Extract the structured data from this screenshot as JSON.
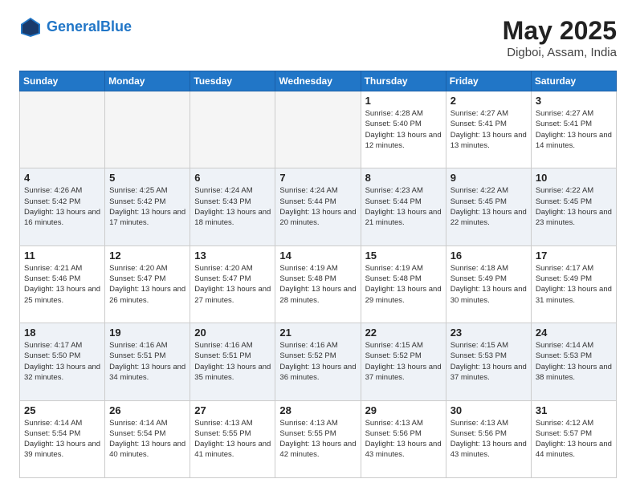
{
  "header": {
    "logo_line1": "General",
    "logo_line2": "Blue",
    "title": "May 2025",
    "subtitle": "Digboi, Assam, India"
  },
  "weekdays": [
    "Sunday",
    "Monday",
    "Tuesday",
    "Wednesday",
    "Thursday",
    "Friday",
    "Saturday"
  ],
  "weeks": [
    [
      {
        "day": "",
        "sunrise": "",
        "sunset": "",
        "daylight": ""
      },
      {
        "day": "",
        "sunrise": "",
        "sunset": "",
        "daylight": ""
      },
      {
        "day": "",
        "sunrise": "",
        "sunset": "",
        "daylight": ""
      },
      {
        "day": "",
        "sunrise": "",
        "sunset": "",
        "daylight": ""
      },
      {
        "day": "1",
        "sunrise": "Sunrise: 4:28 AM",
        "sunset": "Sunset: 5:40 PM",
        "daylight": "Daylight: 13 hours and 12 minutes."
      },
      {
        "day": "2",
        "sunrise": "Sunrise: 4:27 AM",
        "sunset": "Sunset: 5:41 PM",
        "daylight": "Daylight: 13 hours and 13 minutes."
      },
      {
        "day": "3",
        "sunrise": "Sunrise: 4:27 AM",
        "sunset": "Sunset: 5:41 PM",
        "daylight": "Daylight: 13 hours and 14 minutes."
      }
    ],
    [
      {
        "day": "4",
        "sunrise": "Sunrise: 4:26 AM",
        "sunset": "Sunset: 5:42 PM",
        "daylight": "Daylight: 13 hours and 16 minutes."
      },
      {
        "day": "5",
        "sunrise": "Sunrise: 4:25 AM",
        "sunset": "Sunset: 5:42 PM",
        "daylight": "Daylight: 13 hours and 17 minutes."
      },
      {
        "day": "6",
        "sunrise": "Sunrise: 4:24 AM",
        "sunset": "Sunset: 5:43 PM",
        "daylight": "Daylight: 13 hours and 18 minutes."
      },
      {
        "day": "7",
        "sunrise": "Sunrise: 4:24 AM",
        "sunset": "Sunset: 5:44 PM",
        "daylight": "Daylight: 13 hours and 20 minutes."
      },
      {
        "day": "8",
        "sunrise": "Sunrise: 4:23 AM",
        "sunset": "Sunset: 5:44 PM",
        "daylight": "Daylight: 13 hours and 21 minutes."
      },
      {
        "day": "9",
        "sunrise": "Sunrise: 4:22 AM",
        "sunset": "Sunset: 5:45 PM",
        "daylight": "Daylight: 13 hours and 22 minutes."
      },
      {
        "day": "10",
        "sunrise": "Sunrise: 4:22 AM",
        "sunset": "Sunset: 5:45 PM",
        "daylight": "Daylight: 13 hours and 23 minutes."
      }
    ],
    [
      {
        "day": "11",
        "sunrise": "Sunrise: 4:21 AM",
        "sunset": "Sunset: 5:46 PM",
        "daylight": "Daylight: 13 hours and 25 minutes."
      },
      {
        "day": "12",
        "sunrise": "Sunrise: 4:20 AM",
        "sunset": "Sunset: 5:47 PM",
        "daylight": "Daylight: 13 hours and 26 minutes."
      },
      {
        "day": "13",
        "sunrise": "Sunrise: 4:20 AM",
        "sunset": "Sunset: 5:47 PM",
        "daylight": "Daylight: 13 hours and 27 minutes."
      },
      {
        "day": "14",
        "sunrise": "Sunrise: 4:19 AM",
        "sunset": "Sunset: 5:48 PM",
        "daylight": "Daylight: 13 hours and 28 minutes."
      },
      {
        "day": "15",
        "sunrise": "Sunrise: 4:19 AM",
        "sunset": "Sunset: 5:48 PM",
        "daylight": "Daylight: 13 hours and 29 minutes."
      },
      {
        "day": "16",
        "sunrise": "Sunrise: 4:18 AM",
        "sunset": "Sunset: 5:49 PM",
        "daylight": "Daylight: 13 hours and 30 minutes."
      },
      {
        "day": "17",
        "sunrise": "Sunrise: 4:17 AM",
        "sunset": "Sunset: 5:49 PM",
        "daylight": "Daylight: 13 hours and 31 minutes."
      }
    ],
    [
      {
        "day": "18",
        "sunrise": "Sunrise: 4:17 AM",
        "sunset": "Sunset: 5:50 PM",
        "daylight": "Daylight: 13 hours and 32 minutes."
      },
      {
        "day": "19",
        "sunrise": "Sunrise: 4:16 AM",
        "sunset": "Sunset: 5:51 PM",
        "daylight": "Daylight: 13 hours and 34 minutes."
      },
      {
        "day": "20",
        "sunrise": "Sunrise: 4:16 AM",
        "sunset": "Sunset: 5:51 PM",
        "daylight": "Daylight: 13 hours and 35 minutes."
      },
      {
        "day": "21",
        "sunrise": "Sunrise: 4:16 AM",
        "sunset": "Sunset: 5:52 PM",
        "daylight": "Daylight: 13 hours and 36 minutes."
      },
      {
        "day": "22",
        "sunrise": "Sunrise: 4:15 AM",
        "sunset": "Sunset: 5:52 PM",
        "daylight": "Daylight: 13 hours and 37 minutes."
      },
      {
        "day": "23",
        "sunrise": "Sunrise: 4:15 AM",
        "sunset": "Sunset: 5:53 PM",
        "daylight": "Daylight: 13 hours and 37 minutes."
      },
      {
        "day": "24",
        "sunrise": "Sunrise: 4:14 AM",
        "sunset": "Sunset: 5:53 PM",
        "daylight": "Daylight: 13 hours and 38 minutes."
      }
    ],
    [
      {
        "day": "25",
        "sunrise": "Sunrise: 4:14 AM",
        "sunset": "Sunset: 5:54 PM",
        "daylight": "Daylight: 13 hours and 39 minutes."
      },
      {
        "day": "26",
        "sunrise": "Sunrise: 4:14 AM",
        "sunset": "Sunset: 5:54 PM",
        "daylight": "Daylight: 13 hours and 40 minutes."
      },
      {
        "day": "27",
        "sunrise": "Sunrise: 4:13 AM",
        "sunset": "Sunset: 5:55 PM",
        "daylight": "Daylight: 13 hours and 41 minutes."
      },
      {
        "day": "28",
        "sunrise": "Sunrise: 4:13 AM",
        "sunset": "Sunset: 5:55 PM",
        "daylight": "Daylight: 13 hours and 42 minutes."
      },
      {
        "day": "29",
        "sunrise": "Sunrise: 4:13 AM",
        "sunset": "Sunset: 5:56 PM",
        "daylight": "Daylight: 13 hours and 43 minutes."
      },
      {
        "day": "30",
        "sunrise": "Sunrise: 4:13 AM",
        "sunset": "Sunset: 5:56 PM",
        "daylight": "Daylight: 13 hours and 43 minutes."
      },
      {
        "day": "31",
        "sunrise": "Sunrise: 4:12 AM",
        "sunset": "Sunset: 5:57 PM",
        "daylight": "Daylight: 13 hours and 44 minutes."
      }
    ]
  ]
}
